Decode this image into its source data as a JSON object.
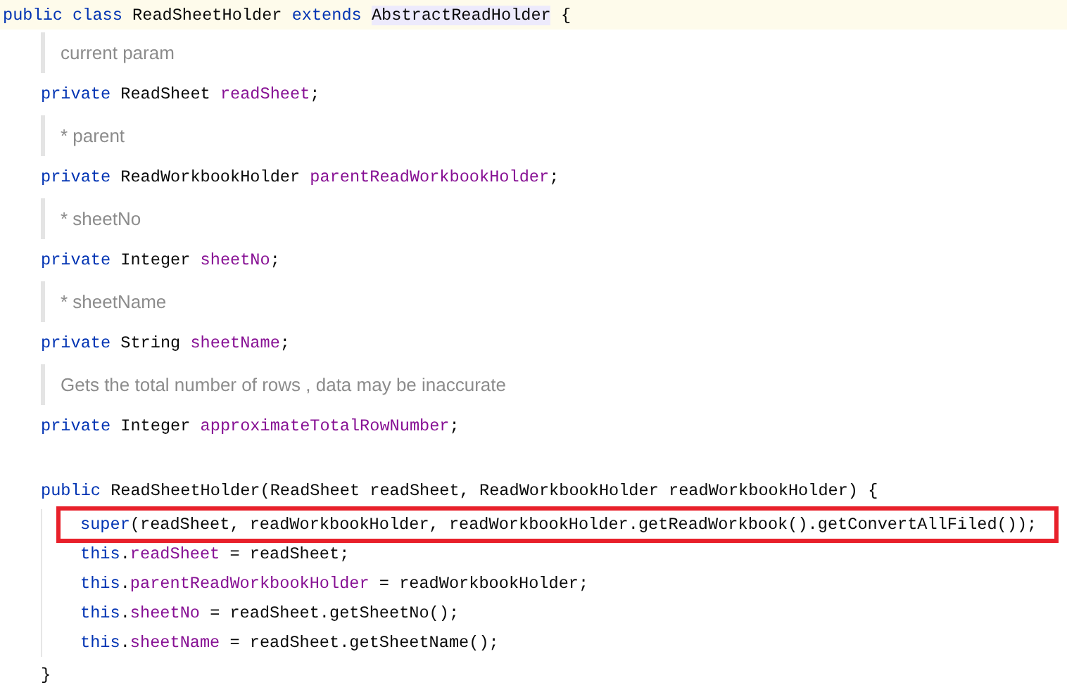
{
  "editor": {
    "lines": [
      {
        "kind": "code",
        "current": true,
        "boxed": false,
        "tokens": [
          {
            "kind": "keyword",
            "text": "public class"
          },
          {
            "kind": "plain",
            "text": " ReadSheetHolder "
          },
          {
            "kind": "keyword",
            "text": "extends "
          },
          {
            "kind": "highlight",
            "text": "AbstractReadHolder"
          },
          {
            "kind": "plain",
            "text": " {"
          }
        ],
        "children": [
          {
            "kind": "doc",
            "text": "current param"
          },
          {
            "kind": "code",
            "current": false,
            "boxed": false,
            "tokens": [
              {
                "kind": "keyword",
                "text": "private"
              },
              {
                "kind": "plain",
                "text": " ReadSheet "
              },
              {
                "kind": "field",
                "text": "readSheet"
              },
              {
                "kind": "plain",
                "text": ";"
              }
            ]
          },
          {
            "kind": "doc",
            "text": "* parent"
          },
          {
            "kind": "code",
            "current": false,
            "boxed": false,
            "tokens": [
              {
                "kind": "keyword",
                "text": "private"
              },
              {
                "kind": "plain",
                "text": " ReadWorkbookHolder "
              },
              {
                "kind": "field",
                "text": "parentReadWorkbookHolder"
              },
              {
                "kind": "plain",
                "text": ";"
              }
            ]
          },
          {
            "kind": "doc",
            "text": "* sheetNo"
          },
          {
            "kind": "code",
            "current": false,
            "boxed": false,
            "tokens": [
              {
                "kind": "keyword",
                "text": "private"
              },
              {
                "kind": "plain",
                "text": " Integer "
              },
              {
                "kind": "field",
                "text": "sheetNo"
              },
              {
                "kind": "plain",
                "text": ";"
              }
            ]
          },
          {
            "kind": "doc",
            "text": "* sheetName"
          },
          {
            "kind": "code",
            "current": false,
            "boxed": false,
            "tokens": [
              {
                "kind": "keyword",
                "text": "private"
              },
              {
                "kind": "plain",
                "text": " String "
              },
              {
                "kind": "field",
                "text": "sheetName"
              },
              {
                "kind": "plain",
                "text": ";"
              }
            ]
          },
          {
            "kind": "doc",
            "text": "Gets the total number of rows , data may be inaccurate"
          },
          {
            "kind": "code",
            "current": false,
            "boxed": false,
            "tokens": [
              {
                "kind": "keyword",
                "text": "private"
              },
              {
                "kind": "plain",
                "text": " Integer "
              },
              {
                "kind": "field",
                "text": "approximateTotalRowNumber"
              },
              {
                "kind": "plain",
                "text": ";"
              }
            ]
          },
          {
            "kind": "blank"
          },
          {
            "kind": "code",
            "current": false,
            "boxed": false,
            "tokens": [
              {
                "kind": "keyword",
                "text": "public"
              },
              {
                "kind": "plain",
                "text": " ReadSheetHolder(ReadSheet readSheet, ReadWorkbookHolder readWorkbookHolder) {"
              }
            ],
            "children": [
              {
                "kind": "code",
                "current": false,
                "boxed": true,
                "tokens": [
                  {
                    "kind": "keyword",
                    "text": "super"
                  },
                  {
                    "kind": "plain",
                    "text": "(readSheet, readWorkbookHolder, readWorkbookHolder.getReadWorkbook().getConvertAllFiled());"
                  }
                ]
              },
              {
                "kind": "code",
                "current": false,
                "boxed": false,
                "tokens": [
                  {
                    "kind": "keyword",
                    "text": "this"
                  },
                  {
                    "kind": "plain",
                    "text": "."
                  },
                  {
                    "kind": "field",
                    "text": "readSheet"
                  },
                  {
                    "kind": "plain",
                    "text": " = readSheet;"
                  }
                ]
              },
              {
                "kind": "code",
                "current": false,
                "boxed": false,
                "tokens": [
                  {
                    "kind": "keyword",
                    "text": "this"
                  },
                  {
                    "kind": "plain",
                    "text": "."
                  },
                  {
                    "kind": "field",
                    "text": "parentReadWorkbookHolder"
                  },
                  {
                    "kind": "plain",
                    "text": " = readWorkbookHolder;"
                  }
                ]
              },
              {
                "kind": "code",
                "current": false,
                "boxed": false,
                "tokens": [
                  {
                    "kind": "keyword",
                    "text": "this"
                  },
                  {
                    "kind": "plain",
                    "text": "."
                  },
                  {
                    "kind": "field",
                    "text": "sheetNo"
                  },
                  {
                    "kind": "plain",
                    "text": " = readSheet.getSheetNo();"
                  }
                ]
              },
              {
                "kind": "code",
                "current": false,
                "boxed": false,
                "tokens": [
                  {
                    "kind": "keyword",
                    "text": "this"
                  },
                  {
                    "kind": "plain",
                    "text": "."
                  },
                  {
                    "kind": "field",
                    "text": "sheetName"
                  },
                  {
                    "kind": "plain",
                    "text": " = readSheet.getSheetName();"
                  }
                ]
              }
            ]
          },
          {
            "kind": "code",
            "current": false,
            "boxed": false,
            "tokens": [
              {
                "kind": "plain",
                "text": "}"
              }
            ]
          }
        ]
      }
    ]
  }
}
